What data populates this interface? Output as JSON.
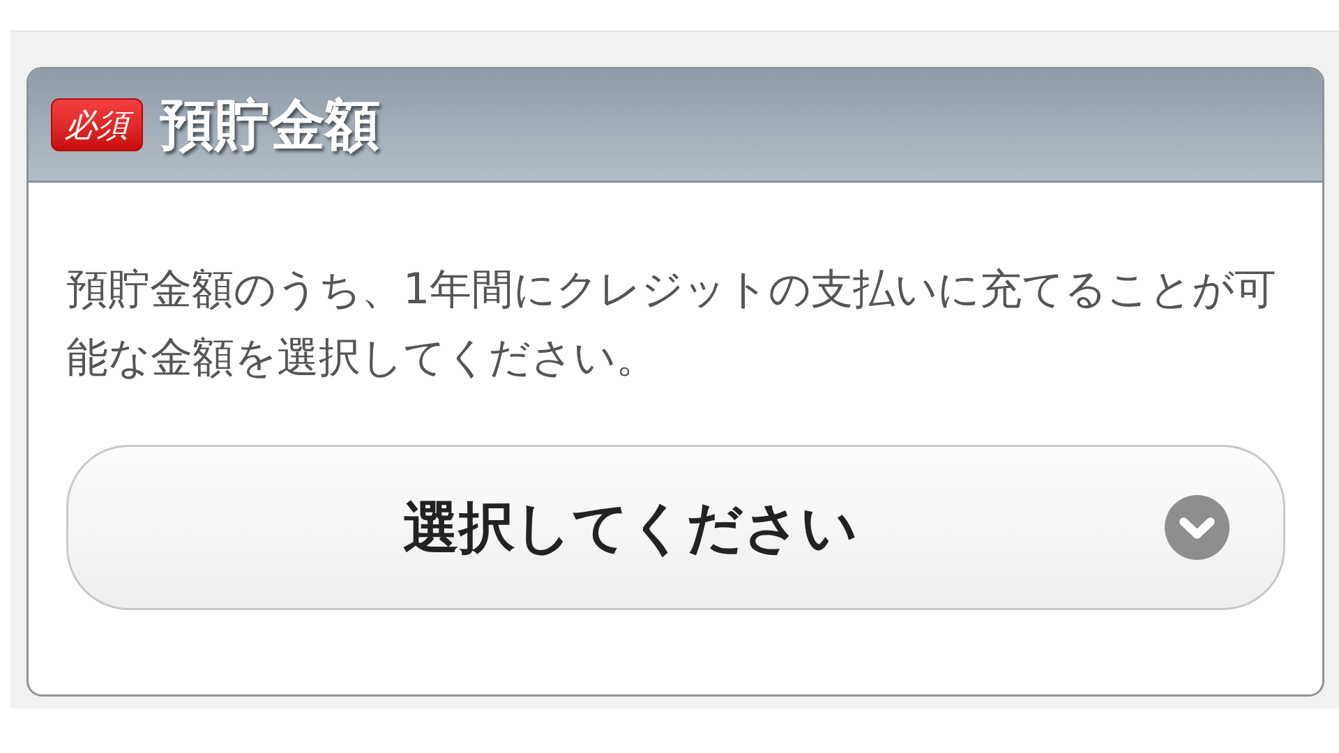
{
  "section": {
    "required_badge": "必須",
    "title": "預貯金額"
  },
  "description": "預貯金額のうち、1年間にクレジットの支払いに充てることが可能な金額を選択してください。",
  "select": {
    "placeholder": "選択してください"
  }
}
